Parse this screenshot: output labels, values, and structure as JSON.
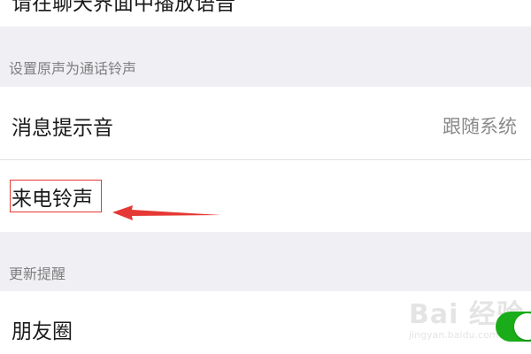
{
  "top_row": {
    "partial_text": "请在聊天界面中播放语音"
  },
  "sections": [
    {
      "header": "设置原声为通话铃声"
    },
    {
      "header": "更新提醒"
    }
  ],
  "rows": {
    "message_tone": {
      "label": "消息提示音",
      "value": "跟随系统"
    },
    "incoming_ringtone": {
      "label": "来电铃声"
    },
    "moments": {
      "label": "朋友圈",
      "toggle_on": true
    }
  },
  "watermark": {
    "brand": "Bai 经验",
    "sub": "jingyan.baidu.com"
  },
  "colors": {
    "accent_green": "#1aad19",
    "annotation_red": "#e53935",
    "background": "#efeff4"
  }
}
